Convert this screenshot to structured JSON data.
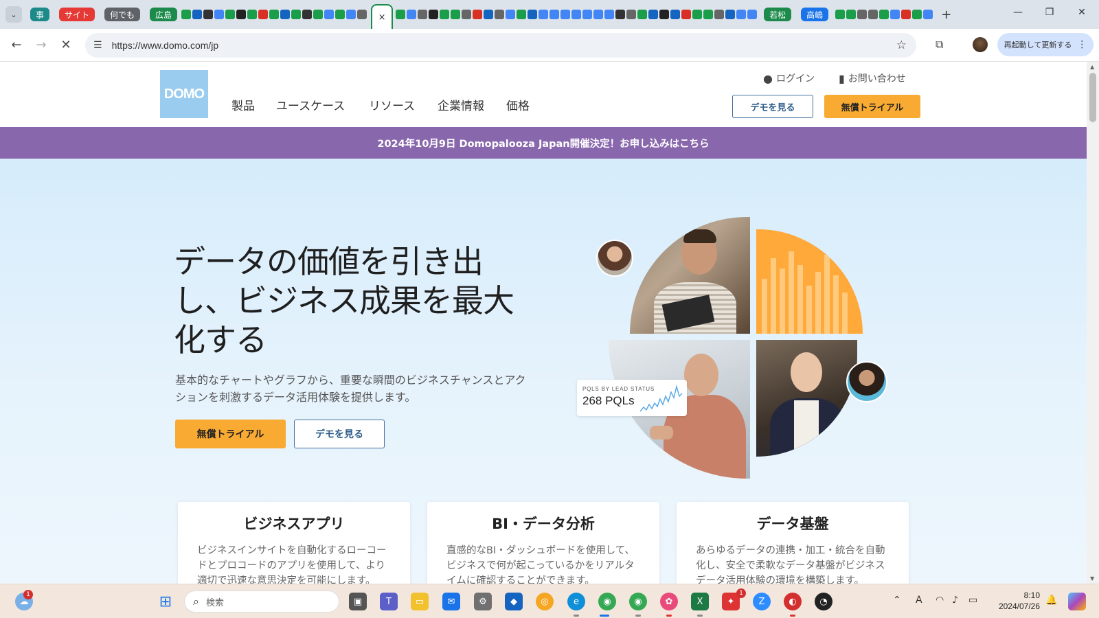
{
  "browser": {
    "tab_groups": [
      "事",
      "サイト",
      "何でも",
      "広島",
      "若松",
      "高嶋"
    ],
    "active_tab_close": "×",
    "new_tab": "+",
    "url": "https://www.domo.com/jp",
    "update_button": "再起動して更新する"
  },
  "site": {
    "logo_text": "DOMO",
    "nav": [
      "製品",
      "ユースケース",
      "リソース",
      "企業情報",
      "価格"
    ],
    "login": "ログイン",
    "contact": "お問い合わせ",
    "header_demo": "デモを見る",
    "header_trial": "無償トライアル",
    "banner": "2024年10月9日 Domopalooza Japan開催決定！お申し込みはこちら"
  },
  "hero": {
    "title": "データの価値を引き出し、ビジネス成果を最大化する",
    "subtitle": "基本的なチャートやグラフから、重要な瞬間のビジネスチャンスとアクションを刺激するデータ活用体験を提供します。",
    "trial_button": "無償トライアル",
    "demo_button": "デモを見る",
    "pql_label": "PQLS BY LEAD STATUS",
    "pql_value": "268 PQLs"
  },
  "cards": [
    {
      "title": "ビジネスアプリ",
      "text": "ビジネスインサイトを自動化するローコードとプロコードのアプリを使用して、より適切で迅速な意思決定を可能にします。"
    },
    {
      "title": "BI・データ分析",
      "text": "直感的なBI・ダッシュボードを使用して、ビジネスで何が起こっているかをリアルタイムに確認することができます。"
    },
    {
      "title": "データ基盤",
      "text": "あらゆるデータの連携・加工・統合を自動化し、安全で柔軟なデータ基盤がビジネスデータ活用体験の環境を構築します。"
    }
  ],
  "taskbar": {
    "search_placeholder": "検索",
    "time": "8:10",
    "date": "2024/07/26",
    "weather_badge": "1",
    "app_badge": "1",
    "ime": "A"
  },
  "colors": {
    "accent_orange": "#f9aa32",
    "banner_purple": "#8867ad",
    "domo_blue": "#99ccee",
    "link_blue": "#2d5c8a"
  }
}
